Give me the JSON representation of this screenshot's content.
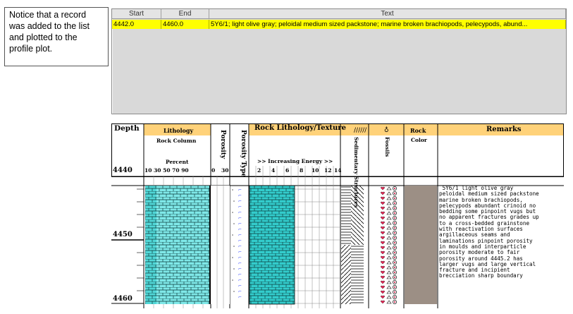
{
  "callout": {
    "text": "Notice that a record was added to the list and plotted to the profile plot."
  },
  "record_list": {
    "columns": [
      "Start",
      "End",
      "Text"
    ],
    "rows": [
      {
        "start": "4442.0",
        "end": "4460.0",
        "text": "5Y6/1; light olive gray; peloidal medium sized packstone; marine broken brachiopods, pelecypods, abund..."
      }
    ]
  },
  "profile": {
    "depth_label": "Depth",
    "lithology_label": "Lithology",
    "rock_column_label": "Rock Column",
    "percent_label": "Percent",
    "percent_ticks": "10  30  50  70  90",
    "porosity_label": "Porosity",
    "porosity_zero": "0",
    "porosity_thirty": "30",
    "porosity_type_label": "Porosity Type",
    "texture_label": "Rock Lithology/Texture",
    "energy_label": ">> Increasing Energy >>",
    "energy_ticks": [
      "2",
      "4",
      "6",
      "8",
      "10",
      "12",
      "14"
    ],
    "sed_label": "Sedimentary Structures",
    "fossils_label": "Fossils",
    "rock_color_label": "Rock",
    "rock_color_label2": "Color",
    "remarks_label": "Remarks",
    "depths": [
      "4440",
      "4450",
      "4460"
    ],
    "remarks_text": " 5Y6/1 light olive gray\npeloidal medium sized packstone\nmarine broken brachiopods,\npelecypods abundant crinoid no\nbedding some pinpoint vugs but\nno apparent fractures grades up\nto a cross-bedded grainstone\nwith reactivation surfaces\nargillaceous seams and\nlaminations pinpoint porosity\nin moulds and interparticle\nporosity moderate to fair\nporosity around 4445.2 has\nlarger vugs and large vertical\nfracture and incipient\nbrecciation sharp boundary",
    "colors": {
      "header": "#ffd27a",
      "limestone": "#33cccc",
      "rock_color": "#9c8f85"
    }
  }
}
